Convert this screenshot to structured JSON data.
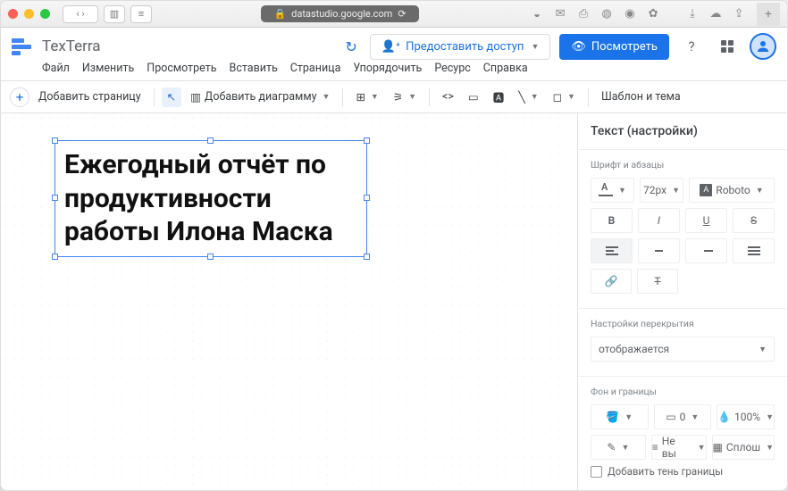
{
  "browser": {
    "url": "datastudio.google.com"
  },
  "app": {
    "name": "TexTerra"
  },
  "menu": {
    "file": "Файл",
    "edit": "Изменить",
    "view": "Просмотреть",
    "insert": "Вставить",
    "page": "Страница",
    "arrange": "Упорядочить",
    "resource": "Ресурс",
    "help": "Справка"
  },
  "topactions": {
    "share": "Предоставить доступ",
    "viewmode": "Посмотреть"
  },
  "toolbar": {
    "addpage": "Добавить страницу",
    "addchart": "Добавить диаграмму",
    "theme": "Шаблон и тема"
  },
  "textblock": {
    "content": "Ежегодный отчёт по продуктивности работы Илона Маска"
  },
  "side": {
    "panel_title": "Текст (настройки)",
    "font_section": "Шрифт и абзацы",
    "fontsize": "72px",
    "fontname": "Roboto",
    "bold": "B",
    "italic": "I",
    "underline": "U",
    "strike": "S",
    "overlay_section": "Настройки перекрытия",
    "overlay_value": "отображается",
    "border_section": "Фон и границы",
    "border_w": "0",
    "opacity": "100%",
    "linestyle": "Не вы",
    "corner": "Сплош",
    "shadow": "Добавить тень границы"
  }
}
